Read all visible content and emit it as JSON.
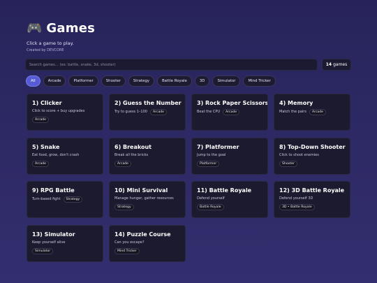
{
  "header": {
    "icon": "gamepad-icon",
    "icon_glyph": "🎮",
    "title": "Games",
    "subtitle": "Click a game to play.",
    "credit": "Created by DEVCORE"
  },
  "search": {
    "placeholder": "Search games... (ex: battle, snake, 3d, shooter)",
    "value": ""
  },
  "count": {
    "number": "14",
    "label": "games"
  },
  "filters": [
    "All",
    "Arcade",
    "Platformer",
    "Shooter",
    "Strategy",
    "Battle Royale",
    "3D",
    "Simulator",
    "Mind Tricker"
  ],
  "active_filter": "All",
  "games": [
    {
      "title": "1) Clicker",
      "desc": "Click to score + buy upgrades",
      "tag": "Arcade"
    },
    {
      "title": "2) Guess the Number",
      "desc": "Try to guess 1–100",
      "tag": "Arcade"
    },
    {
      "title": "3) Rock Paper Scissors",
      "desc": "Beat the CPU",
      "tag": "Arcade"
    },
    {
      "title": "4) Memory",
      "desc": "Match the pairs",
      "tag": "Arcade"
    },
    {
      "title": "5) Snake",
      "desc": "Eat food, grow, don't crash",
      "tag": "Arcade"
    },
    {
      "title": "6) Breakout",
      "desc": "Break all the bricks",
      "tag": "Arcade"
    },
    {
      "title": "7) Platformer",
      "desc": "Jump to the goal",
      "tag": "Platformer"
    },
    {
      "title": "8) Top-Down Shooter",
      "desc": "Click to shoot enemies",
      "tag": "Shooter"
    },
    {
      "title": "9) RPG Battle",
      "desc": "Turn-based fight",
      "tag": "Strategy"
    },
    {
      "title": "10) Mini Survival",
      "desc": "Manage hunger, gather resources",
      "tag": "Strategy"
    },
    {
      "title": "11) Battle Royale",
      "desc": "Defend yourself",
      "tag": "Battle Royale"
    },
    {
      "title": "12) 3D Battle Royale",
      "desc": "Defend yourself 3D",
      "tag": "3D • Battle Royale"
    },
    {
      "title": "13) Simulator",
      "desc": "Keep yourself alive",
      "tag": "Simulator"
    },
    {
      "title": "14) Puzzle Course",
      "desc": "Can you escape?",
      "tag": "Mind Tricker"
    }
  ],
  "colors": {
    "background": "#2b2760",
    "card": "#1c1a2e",
    "accent": "#575bd6"
  }
}
